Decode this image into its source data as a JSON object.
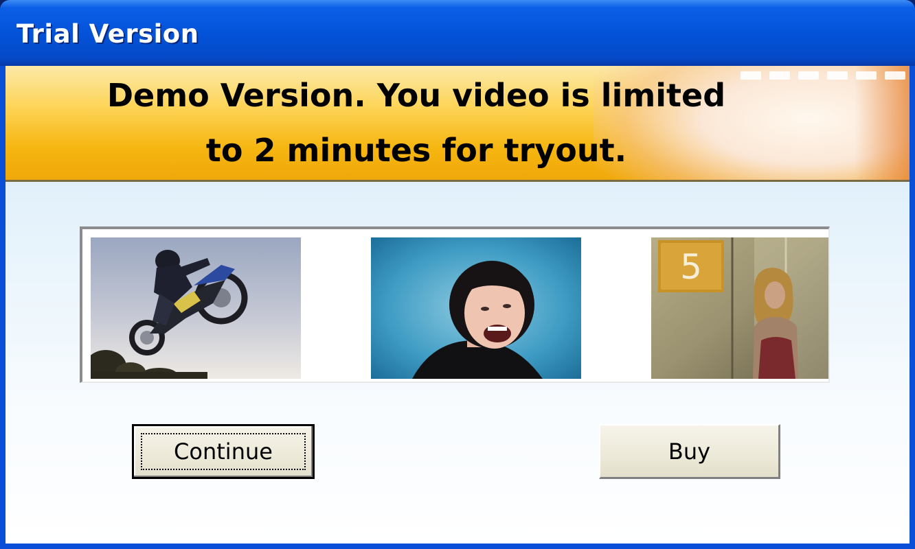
{
  "window": {
    "title": "Trial Version"
  },
  "banner": {
    "line1": "Demo Version. You video is limited",
    "line2": "to 2 minutes for tryout."
  },
  "thumbnails": [
    {
      "name": "motocross-jump-thumbnail"
    },
    {
      "name": "laughing-woman-thumbnail"
    },
    {
      "name": "woman-elevator-thumbnail",
      "sign_text": "5"
    }
  ],
  "buttons": {
    "continue_label": "Continue",
    "buy_label": "Buy"
  },
  "colors": {
    "titlebar": "#0453d9",
    "banner": "#f6b610",
    "button_face": "#ece9d8"
  }
}
